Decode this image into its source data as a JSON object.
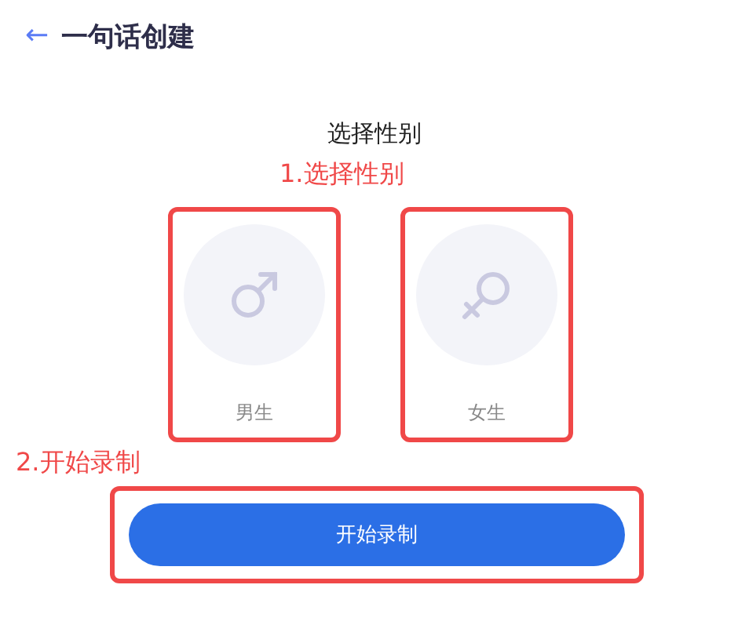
{
  "header": {
    "back_icon": "←",
    "title": "一句话创建"
  },
  "section_title": "选择性别",
  "annotations": [
    "1.选择性别",
    "2.开始录制"
  ],
  "options": [
    {
      "kind": "male",
      "label": "男生"
    },
    {
      "kind": "female",
      "label": "女生"
    }
  ],
  "primary_button": "开始录制"
}
